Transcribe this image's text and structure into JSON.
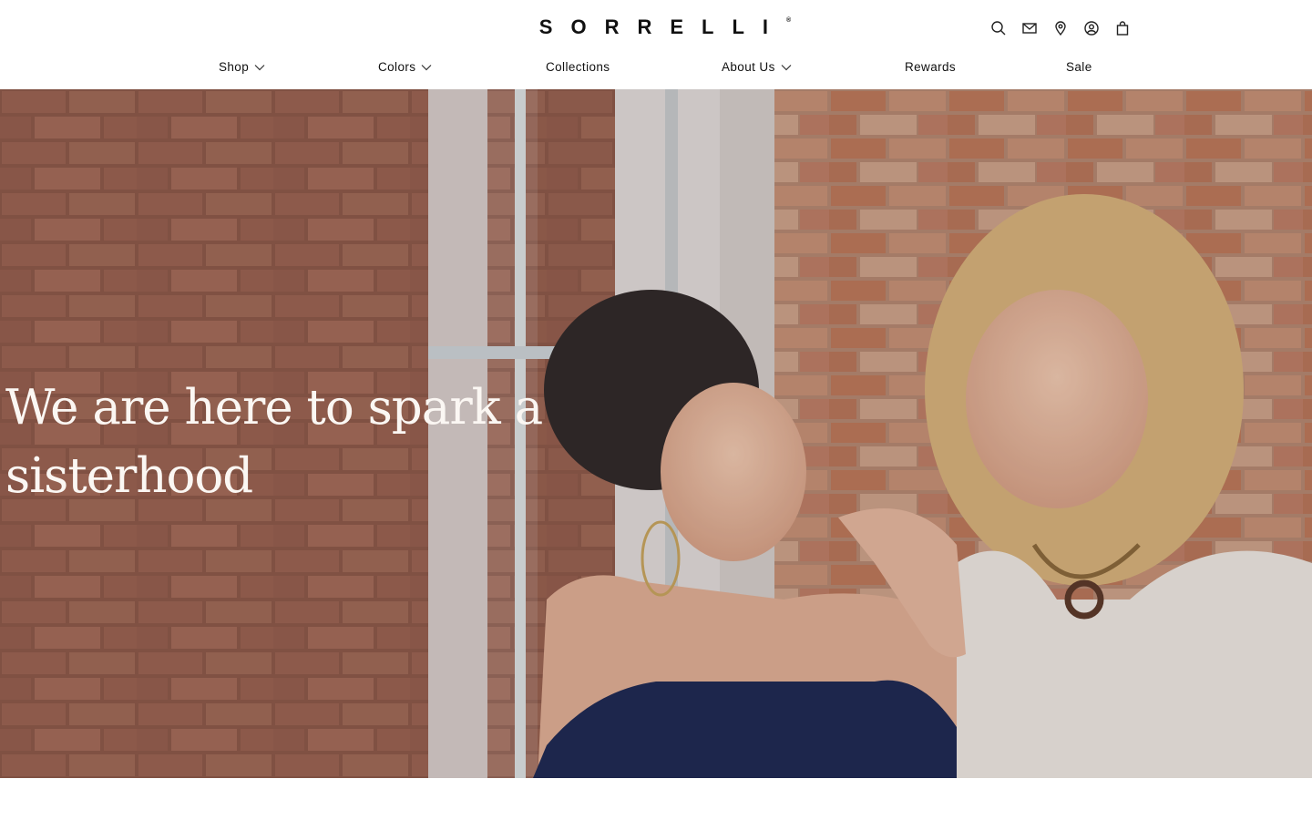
{
  "brand": {
    "logo": "SORRELLI",
    "registered": "®"
  },
  "utility_icons": [
    "search-icon",
    "mail-icon",
    "location-pin-icon",
    "account-icon",
    "shopping-bag-icon"
  ],
  "nav": {
    "items": [
      {
        "label": "Shop",
        "has_dropdown": true
      },
      {
        "label": "Colors",
        "has_dropdown": true
      },
      {
        "label": "Collections",
        "has_dropdown": false
      },
      {
        "label": "About Us",
        "has_dropdown": true
      },
      {
        "label": "Rewards",
        "has_dropdown": false
      },
      {
        "label": "Sale",
        "has_dropdown": false
      }
    ]
  },
  "hero": {
    "heading_line1": "We are here to spark a",
    "heading_line2": "sisterhood"
  },
  "colors": {
    "text": "#111111",
    "background": "#ffffff",
    "hero_text": "#fbf7f3",
    "brick": "#9a6150"
  }
}
